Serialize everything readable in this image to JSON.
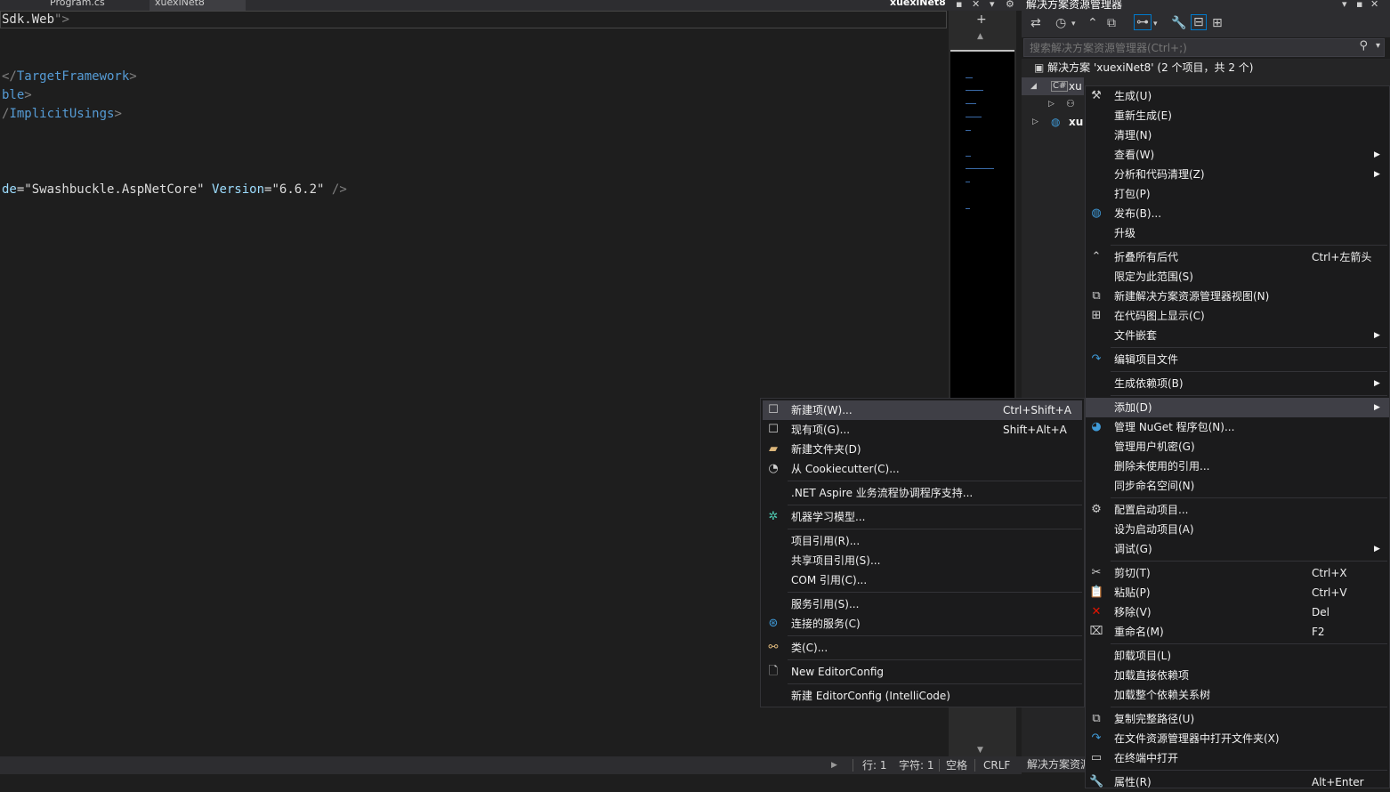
{
  "tabs": [
    {
      "label": "Program.cs"
    },
    {
      "label": "xuexiNet8"
    }
  ],
  "document_title": "xuexiNet8",
  "editor": {
    "lines": {
      "l1": {
        "a": "Sdk.Web",
        "b": "\">"
      },
      "l2": {
        "a": "</",
        "b": "TargetFramework",
        "c": ">"
      },
      "l3": {
        "a": "ble",
        "b": ">"
      },
      "l4": {
        "a": "/",
        "b": "ImplicitUsings",
        "c": ">"
      },
      "l5": {
        "a": "de",
        "b": "=\"",
        "c": "Swashbuckle.AspNetCore",
        "d": "\"",
        "e": " Version",
        "f": "=\"",
        "g": "6.6.2",
        "h": "\"",
        "i": " />"
      }
    }
  },
  "status": {
    "line": "行: 1",
    "char": "字符: 1",
    "spaces": "空格",
    "eol": "CRLF"
  },
  "solution_explorer": {
    "title": "解决方案资源管理器",
    "search_placeholder": "搜索解决方案资源管理器(Ctrl+;)",
    "solution_node": "解决方案 'xuexiNet8' (2 个项目，共 2 个)",
    "project_node": "xu",
    "project_node2": "xu",
    "bottom_tab": "解决方案资源"
  },
  "context_menu": [
    {
      "label": "生成(U)",
      "icon": "build-icon"
    },
    {
      "label": "重新生成(E)"
    },
    {
      "label": "清理(N)"
    },
    {
      "label": "查看(W)",
      "submenu": true
    },
    {
      "label": "分析和代码清理(Z)",
      "submenu": true
    },
    {
      "label": "打包(P)"
    },
    {
      "label": "发布(B)...",
      "icon": "globe-icon"
    },
    {
      "label": "升级"
    },
    {
      "label": "折叠所有后代",
      "shortcut": "Ctrl+左箭头",
      "icon": "collapse-icon"
    },
    {
      "label": "限定为此范围(S)"
    },
    {
      "label": "新建解决方案资源管理器视图(N)",
      "icon": "new-view-icon"
    },
    {
      "label": "在代码图上显示(C)",
      "icon": "code-map-icon"
    },
    {
      "label": "文件嵌套",
      "submenu": true
    },
    {
      "label": "编辑项目文件",
      "icon": "redo-icon"
    },
    {
      "label": "生成依赖项(B)",
      "submenu": true
    },
    {
      "label": "添加(D)",
      "submenu": true
    },
    {
      "label": "管理 NuGet 程序包(N)...",
      "icon": "nuget-icon"
    },
    {
      "label": "管理用户机密(G)"
    },
    {
      "label": "删除未使用的引用..."
    },
    {
      "label": "同步命名空间(N)"
    },
    {
      "label": "配置启动项目...",
      "icon": "gear-icon"
    },
    {
      "label": "设为启动项目(A)"
    },
    {
      "label": "调试(G)",
      "submenu": true
    },
    {
      "label": "剪切(T)",
      "shortcut": "Ctrl+X",
      "icon": "scissors-icon"
    },
    {
      "label": "粘贴(P)",
      "shortcut": "Ctrl+V",
      "icon": "paste-icon"
    },
    {
      "label": "移除(V)",
      "shortcut": "Del",
      "icon": "remove-icon"
    },
    {
      "label": "重命名(M)",
      "shortcut": "F2",
      "icon": "rename-icon"
    },
    {
      "label": "卸载项目(L)"
    },
    {
      "label": "加载直接依赖项"
    },
    {
      "label": "加载整个依赖关系树"
    },
    {
      "label": "复制完整路径(U)",
      "icon": "copy-icon"
    },
    {
      "label": "在文件资源管理器中打开文件夹(X)",
      "icon": "open-folder-icon"
    },
    {
      "label": "在终端中打开",
      "icon": "terminal-icon"
    },
    {
      "label": "属性(R)",
      "shortcut": "Alt+Enter",
      "icon": "wrench-icon"
    }
  ],
  "add_submenu": [
    {
      "label": "新建项(W)...",
      "shortcut": "Ctrl+Shift+A",
      "icon": "new-item-icon"
    },
    {
      "label": "现有项(G)...",
      "shortcut": "Shift+Alt+A",
      "icon": "existing-item-icon"
    },
    {
      "label": "新建文件夹(D)",
      "icon": "folder-icon"
    },
    {
      "label": "从 Cookiecutter(C)...",
      "icon": "cookiecutter-icon"
    },
    {
      "label": ".NET Aspire 业务流程协调程序支持..."
    },
    {
      "label": "机器学习模型...",
      "icon": "ml-icon"
    },
    {
      "label": "项目引用(R)..."
    },
    {
      "label": "共享项目引用(S)..."
    },
    {
      "label": "COM 引用(C)..."
    },
    {
      "label": "服务引用(S)..."
    },
    {
      "label": "连接的服务(C)",
      "icon": "connected-service-icon"
    },
    {
      "label": "类(C)...",
      "icon": "class-icon"
    },
    {
      "label": "New EditorConfig",
      "icon": "file-icon"
    },
    {
      "label": "新建 EditorConfig (IntelliCode)"
    }
  ],
  "colors": {
    "accent": "#569cd6",
    "attr": "#9cdcfe",
    "string": "#d69d85",
    "remove": "#e51400",
    "nuget": "#3f9ad8",
    "ml": "#4ec9b0"
  }
}
